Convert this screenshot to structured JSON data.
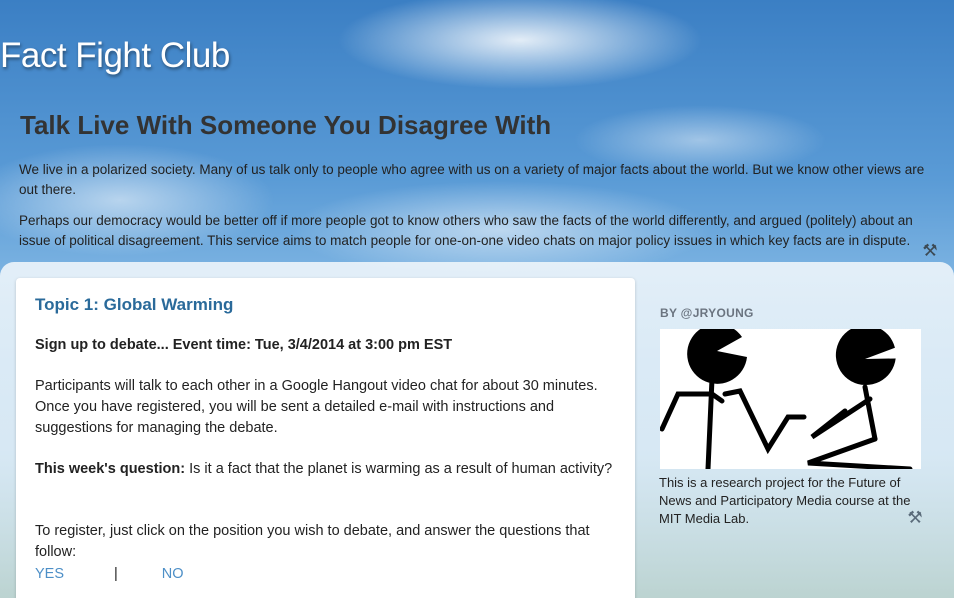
{
  "header": {
    "blog_title": "Fact Fight Club"
  },
  "description": {
    "title": "Talk Live With Someone You Disagree With",
    "paragraph1": "We live in a polarized society. Many of us talk only to people who agree with us on a variety of major facts about the world. But we know other views are out there.",
    "paragraph2": "Perhaps our democracy would be better off if more people got to know others who saw the facts of the world differently, and argued (politely) about an issue of political disagreement. This service aims to match people for one-on-one video chats on major policy issues in which key facts are in dispute."
  },
  "post": {
    "title": "Topic 1: Global Warming",
    "signup": "Sign up to debate... Event time: Tue, 3/4/2014 at 3:00 pm EST",
    "participants": "Participants will talk to each other in a Google Hangout video chat for about 30 minutes. Once you have registered, you will be sent a detailed e-mail with instructions and suggestions for managing the debate.",
    "question_label": "This week's question:",
    "question_text": " Is it a fact that the planet is warming as a result of human activity?",
    "register_text": "To register, just click on the position you wish to debate, and answer the questions that follow:",
    "yes_label": "YES",
    "separator": "|",
    "no_label": "NO"
  },
  "sidebar": {
    "heading": "BY @JRYOUNG",
    "caption": "This is a research project for the Future of News and Participatory Media course at the MIT Media Lab."
  },
  "icons": {
    "edit": "wrench-screwdriver-icon"
  },
  "colors": {
    "link": "#4d8fc7",
    "post_title": "#2a6a9a",
    "heading_text": "#333333"
  }
}
